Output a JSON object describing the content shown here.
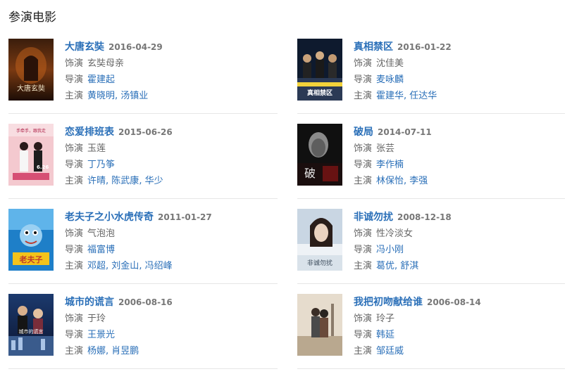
{
  "section_title": "参演电影",
  "labels": {
    "role": "饰演",
    "director": "导演",
    "cast": "主演"
  },
  "movies": [
    {
      "title": "大唐玄奘",
      "date": "2016-04-29",
      "role": "玄奘母亲",
      "director": "霍建起",
      "cast": [
        "黄晓明",
        "汤镇业"
      ]
    },
    {
      "title": "真相禁区",
      "date": "2016-01-22",
      "role": "沈佳美",
      "director": "麦咏麟",
      "cast": [
        "霍建华",
        "任达华"
      ]
    },
    {
      "title": "恋爱排班表",
      "date": "2015-06-26",
      "role": "玉莲",
      "director": "丁乃筝",
      "cast": [
        "许晴",
        "陈武康",
        "华少"
      ]
    },
    {
      "title": "破局",
      "date": "2014-07-11",
      "role": "张芸",
      "director": "李作楠",
      "cast": [
        "林保怡",
        "李强"
      ]
    },
    {
      "title": "老夫子之小水虎传奇",
      "date": "2011-01-27",
      "role": "气泡泡",
      "director": "福富博",
      "cast": [
        "邓超",
        "刘金山",
        "冯绍峰"
      ]
    },
    {
      "title": "非诚勿扰",
      "date": "2008-12-18",
      "role": "性冷淡女",
      "director": "冯小刚",
      "cast": [
        "葛优",
        "舒淇"
      ]
    },
    {
      "title": "城市的谎言",
      "date": "2006-08-16",
      "role": "于玲",
      "director": "王景光",
      "cast": [
        "杨娜",
        "肖昱鹏"
      ]
    },
    {
      "title": "我把初吻献给谁",
      "date": "2006-08-14",
      "role": "玲子",
      "director": "韩延",
      "cast": [
        "邹廷威"
      ]
    }
  ],
  "poster_texts": {
    "p0": "大唐玄奘",
    "p1": "真相禁区",
    "p2": "手牵手，跟我走",
    "p2b": "6.26",
    "p3": "破",
    "p4": "老夫子",
    "p5": "非诚勿扰",
    "p6": "城市的谎言"
  }
}
